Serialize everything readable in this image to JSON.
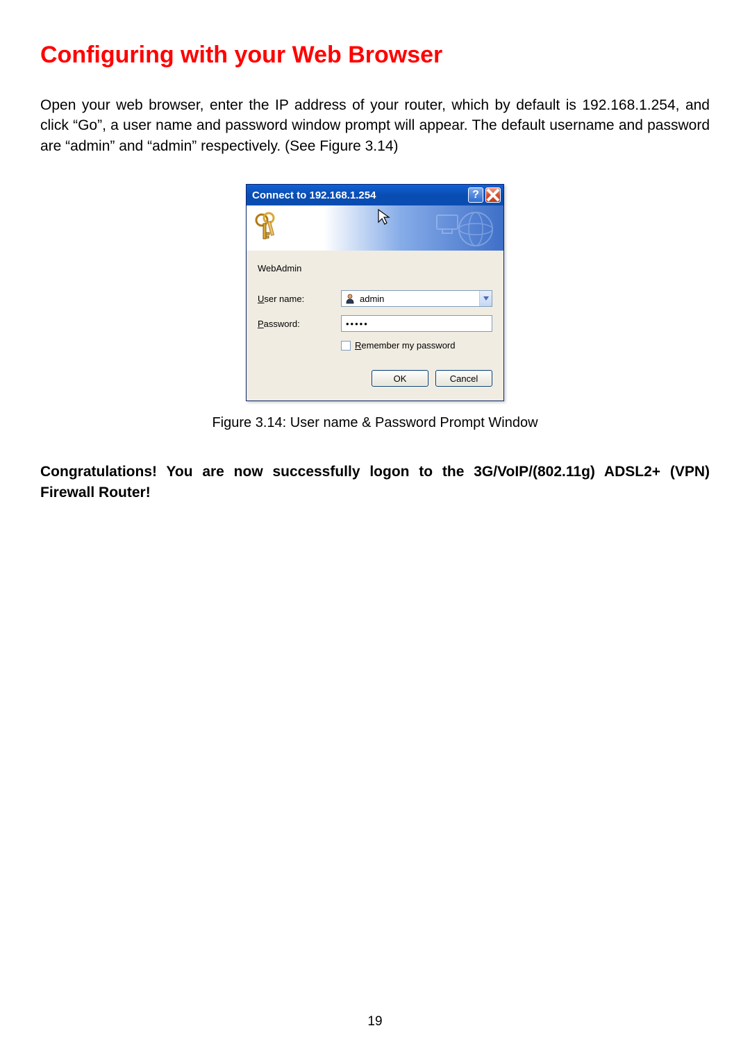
{
  "heading": "Configuring with your Web Browser",
  "intro": "Open your web browser, enter the IP address of your router, which by default is 192.168.1.254, and click “Go”, a user name and password window prompt will appear. The default username and password are “admin” and “admin” respectively. (See Figure 3.14)",
  "dialog": {
    "title": "Connect to 192.168.1.254",
    "realm": "WebAdmin",
    "username_label_pre": "U",
    "username_label_post": "ser name:",
    "username_value": "admin",
    "password_label_pre": "P",
    "password_label_post": "assword:",
    "password_value": "•••••",
    "remember_pre": "R",
    "remember_post": "emember my password",
    "ok_label": "OK",
    "cancel_label": "Cancel"
  },
  "figure_caption": "Figure 3.14: User name & Password Prompt Window",
  "congrats": "Congratulations! You are now successfully logon to the 3G/VoIP/(802.11g) ADSL2+ (VPN) Firewall Router!",
  "page_number": "19"
}
